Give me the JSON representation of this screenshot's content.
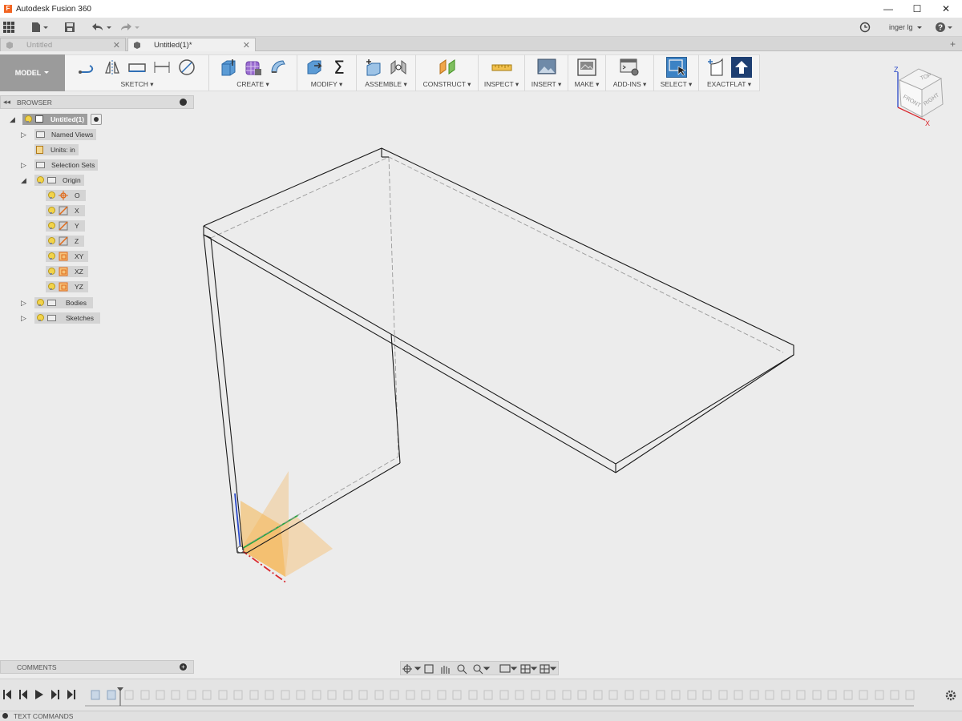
{
  "app": {
    "title": "Autodesk Fusion 360",
    "logo_letter": "F"
  },
  "window_controls": {
    "minimize": "—",
    "maximize": "☐",
    "close": "✕"
  },
  "qat": {
    "user": "inger lg",
    "help": "?"
  },
  "tabs": [
    {
      "label": "Untitled",
      "active": false
    },
    {
      "label": "Untitled(1)*",
      "active": true
    }
  ],
  "workspace": {
    "label": "MODEL"
  },
  "ribbon_groups": [
    {
      "label": "SKETCH"
    },
    {
      "label": "CREATE"
    },
    {
      "label": "MODIFY"
    },
    {
      "label": "ASSEMBLE"
    },
    {
      "label": "CONSTRUCT"
    },
    {
      "label": "INSPECT"
    },
    {
      "label": "INSERT"
    },
    {
      "label": "MAKE"
    },
    {
      "label": "ADD-INS"
    },
    {
      "label": "SELECT"
    },
    {
      "label": "EXACTFLAT"
    }
  ],
  "browser": {
    "label": "BROWSER",
    "root": "Untitled(1)",
    "items": {
      "named_views": "Named Views",
      "units": "Units: in",
      "selection_sets": "Selection Sets",
      "origin": "Origin",
      "o": "O",
      "x": "X",
      "y": "Y",
      "z": "Z",
      "xy": "XY",
      "xz": "XZ",
      "yz": "YZ",
      "bodies": "Bodies",
      "sketches": "Sketches"
    }
  },
  "comments": {
    "label": "COMMENTS"
  },
  "text_commands": {
    "label": "TEXT COMMANDS"
  },
  "viewcube": {
    "top": "TOP",
    "front": "FRONT",
    "right": "RIGHT",
    "z_axis": "Z",
    "x_axis": "X"
  },
  "colors": {
    "accent": "#3c82c4",
    "plane": "#f5c27a",
    "axis_x": "#d9262c",
    "axis_y": "#26a640",
    "axis_z": "#2a48c8"
  }
}
